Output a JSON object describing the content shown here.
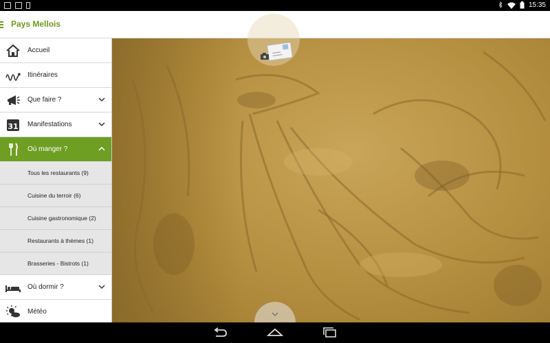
{
  "status_bar": {
    "time": "15:35",
    "icons": [
      "gmail-icon",
      "calendar-check-icon",
      "barcode-icon",
      "bluetooth-icon",
      "wifi-icon",
      "battery-icon"
    ]
  },
  "action_bar": {
    "title": "Pays Mellois"
  },
  "drawer": {
    "items": [
      {
        "label": "Accueil",
        "icon": "home-icon"
      },
      {
        "label": "Itinéraires",
        "icon": "route-icon"
      },
      {
        "label": "Que faire ?",
        "icon": "megaphone-icon",
        "expandable": true
      },
      {
        "label": "Manifestations",
        "icon": "calendar-31-icon",
        "expandable": true
      },
      {
        "label": "Où manger ?",
        "icon": "fork-knife-icon",
        "expandable": true,
        "expanded": true
      },
      {
        "label": "Où dormir ?",
        "icon": "bed-icon",
        "expandable": true
      },
      {
        "label": "Météo",
        "icon": "weather-icon"
      }
    ],
    "sub_items": [
      {
        "label": "Tous les restaurants (9)"
      },
      {
        "label": "Cuisine du terroir (6)"
      },
      {
        "label": "Cuisine gastronomique (2)"
      },
      {
        "label": "Restaurants à thèmes (1)"
      },
      {
        "label": "Brasseries - Bistrots (1)"
      }
    ]
  },
  "colors": {
    "accent": "#6e9e22",
    "title_green": "#6c9b1e",
    "hero_tone": "#b58f3f"
  }
}
